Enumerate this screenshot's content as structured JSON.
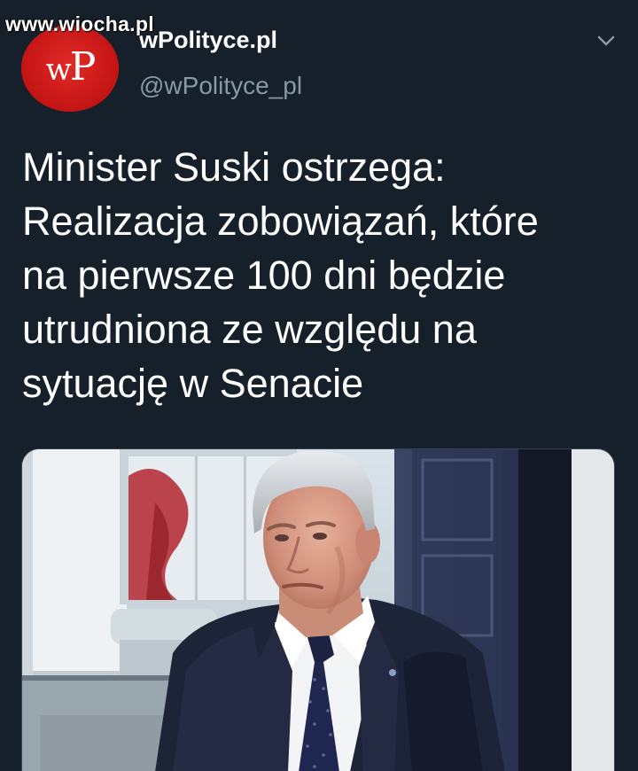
{
  "watermark": "www.wiocha.pl",
  "tweet": {
    "avatar_logo_w": "w",
    "avatar_logo_p": "P",
    "display_name": "wPolityce.pl",
    "handle": "@wPolityce_pl",
    "text": "Minister Suski ostrzega:\nRealizacja zobowiązań, które\nna pierwsze 100 dni będzie\nutrudniona ze względu na\nsytuację w Senacie"
  },
  "icons": {
    "menu_caret": "chevron-down-icon"
  },
  "colors": {
    "background": "#15202b",
    "secondary_text": "#8899a6",
    "avatar_red": "#d01818"
  }
}
